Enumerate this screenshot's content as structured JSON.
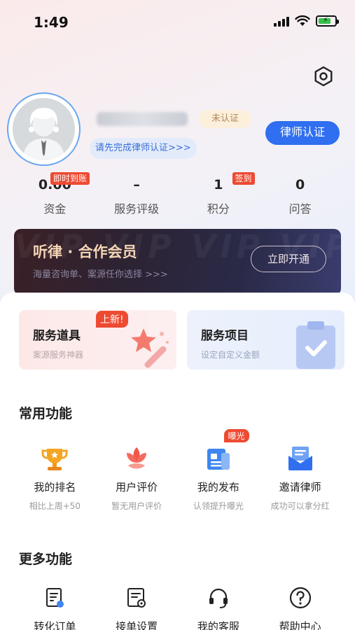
{
  "status_bar": {
    "time": "1:49"
  },
  "profile": {
    "verification_badge": "未认证",
    "verify_hint": "请先完成律师认证>>>",
    "verify_button": "律师认证"
  },
  "stats": [
    {
      "value": "0.00",
      "label": "资金",
      "tag": "即时到账"
    },
    {
      "value": "–",
      "label": "服务评级",
      "tag": ""
    },
    {
      "value": "1",
      "label": "积分",
      "tag": "签到"
    },
    {
      "value": "0",
      "label": "问答",
      "tag": ""
    }
  ],
  "vip_banner": {
    "title": "听律 · 合作会员",
    "subtitle": "海量咨询单、案源任你选择 >>>",
    "button": "立即开通",
    "watermark": "VIP VIP VIP VIP VIP VIP"
  },
  "promos": {
    "tools": {
      "title": "服务道具",
      "subtitle": "案源服务神器",
      "tag": "上新!"
    },
    "services": {
      "title": "服务项目",
      "subtitle": "设定自定义金额"
    }
  },
  "common_functions": {
    "title": "常用功能",
    "items": [
      {
        "label": "我的排名",
        "sub": "相比上周+50",
        "icon": "trophy-icon"
      },
      {
        "label": "用户评价",
        "sub": "暂无用户评价",
        "icon": "lotus-icon"
      },
      {
        "label": "我的发布",
        "sub": "认领提升曝光",
        "icon": "publish-icon",
        "tag": "曝光"
      },
      {
        "label": "邀请律师",
        "sub": "成功可以拿分红",
        "icon": "envelope-icon"
      }
    ]
  },
  "more_functions": {
    "title": "更多功能",
    "items": [
      {
        "label": "转化订单",
        "icon": "order-icon"
      },
      {
        "label": "接单设置",
        "icon": "order-settings-icon"
      },
      {
        "label": "我的客服",
        "icon": "headset-icon"
      },
      {
        "label": "帮助中心",
        "icon": "help-icon"
      }
    ]
  },
  "colors": {
    "primary": "#2f6ff0",
    "tag_red": "#ee4a32",
    "vip_gold": "#f4d5b4"
  }
}
